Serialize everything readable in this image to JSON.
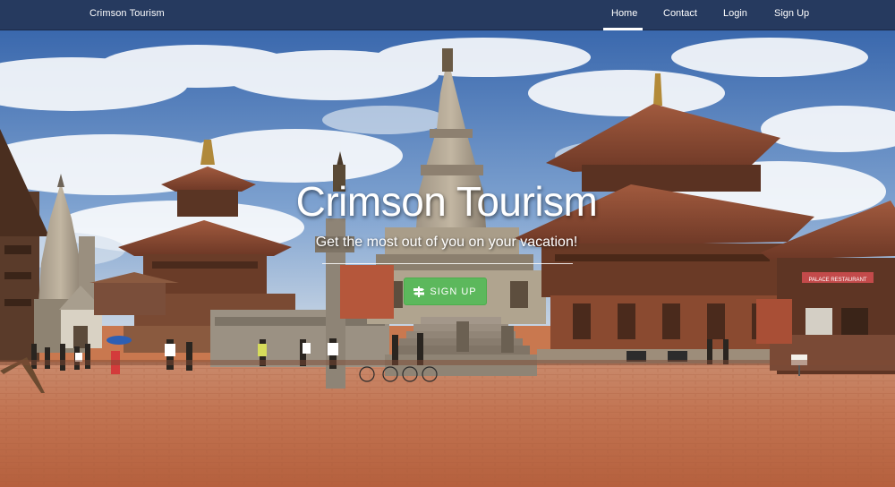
{
  "nav": {
    "brand": "Crimson Tourism",
    "links": [
      {
        "label": "Home",
        "active": true
      },
      {
        "label": "Contact",
        "active": false
      },
      {
        "label": "Login",
        "active": false
      },
      {
        "label": "Sign Up",
        "active": false
      }
    ]
  },
  "hero": {
    "title": "Crimson Tourism",
    "subtitle": "Get the most out of you on your vacation!",
    "cta_label": "SIGN UP",
    "cta_icon": "signpost-icon",
    "sign_text": "PALACE RESTAURANT"
  },
  "colors": {
    "navbar": "#263a5f",
    "cta": "#5cb85c",
    "plaza": "#c07250",
    "sky": "#3f72b8"
  }
}
